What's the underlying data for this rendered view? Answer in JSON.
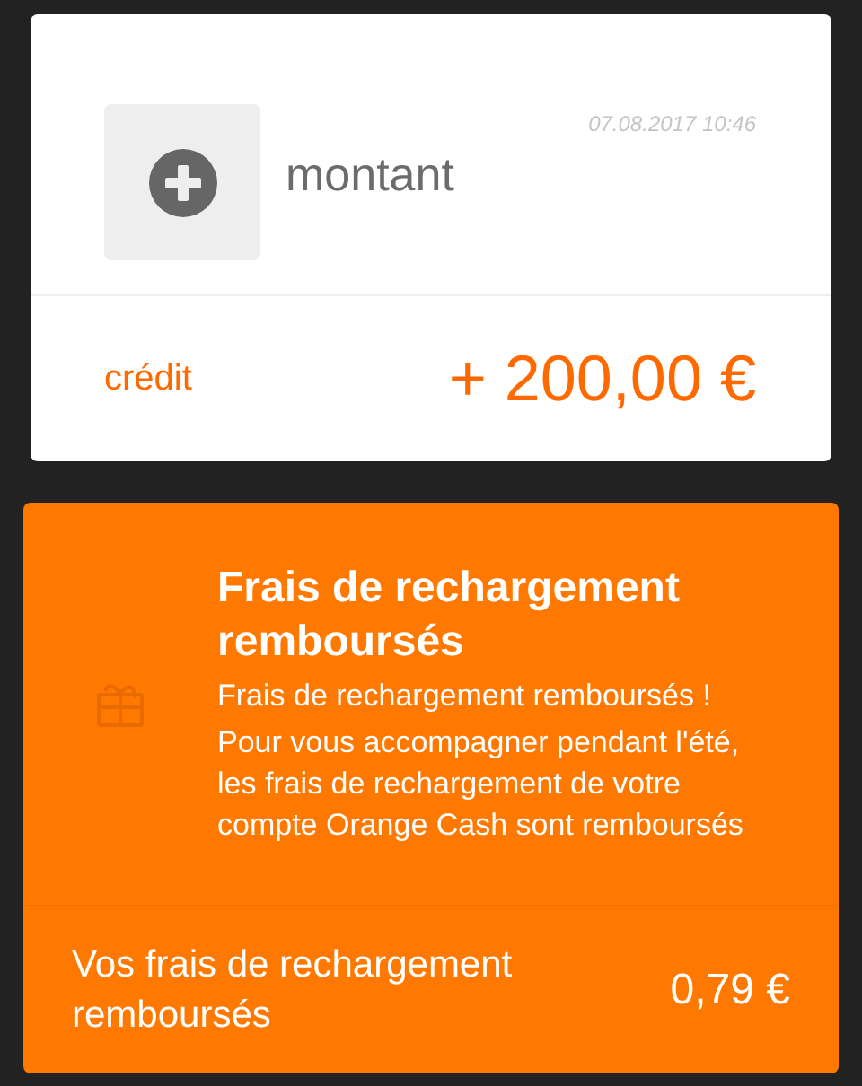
{
  "transaction": {
    "date": "07.08.2017 10:46",
    "label": "montant",
    "type": "crédit",
    "amount": "+ 200,00 €"
  },
  "offer": {
    "title": "Frais de rechargement remboursés",
    "subtitle": "Frais de rechargement remboursés !",
    "description": "Pour vous accompagner pendant l'été, les frais de rechargement de votre compte Orange Cash sont remboursés",
    "footer_label": "Vos frais de rechargement remboursés",
    "footer_amount": "0,79 €"
  }
}
